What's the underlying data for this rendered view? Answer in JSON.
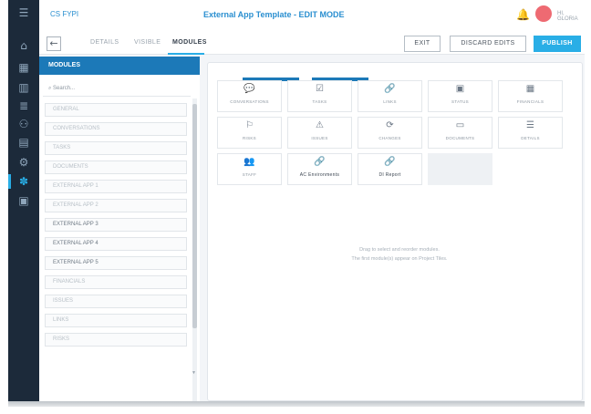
{
  "header": {
    "breadcrumb": "CS FYPI",
    "title": "External App Template - EDIT MODE",
    "user_label": "HI, GLORIA"
  },
  "rail": {
    "icons": [
      "menu-icon",
      "home-icon",
      "grid-icon",
      "chart-icon",
      "list-icon",
      "people-icon",
      "folder-icon",
      "settings-icon",
      "puzzle-icon",
      "calendar-icon"
    ],
    "active_index": 8
  },
  "tabs": [
    {
      "label": "DETAILS",
      "active": false
    },
    {
      "label": "VISIBLE",
      "active": false
    },
    {
      "label": "MODULES",
      "active": true
    }
  ],
  "buttons": {
    "exit": "EXIT",
    "discard": "DISCARD EDITS",
    "publish": "PUBLISH"
  },
  "modules_panel": {
    "title": "MODULES",
    "search_placeholder": "Search...",
    "items": [
      {
        "label": "GENERAL",
        "dark": false
      },
      {
        "label": "CONVERSATIONS",
        "dark": false
      },
      {
        "label": "TASKS",
        "dark": false
      },
      {
        "label": "DOCUMENTS",
        "dark": false
      },
      {
        "label": "EXTERNAL APP 1",
        "dark": false
      },
      {
        "label": "EXTERNAL APP 2",
        "dark": false
      },
      {
        "label": "EXTERNAL APP 3",
        "dark": true
      },
      {
        "label": "EXTERNAL APP 4",
        "dark": true
      },
      {
        "label": "EXTERNAL APP 5",
        "dark": true
      },
      {
        "label": "FINANCIALS",
        "dark": false
      },
      {
        "label": "ISSUES",
        "dark": false
      },
      {
        "label": "LINKS",
        "dark": false
      },
      {
        "label": "RISKS",
        "dark": false
      }
    ]
  },
  "board": {
    "tiles": [
      {
        "label": "CONVERSATIONS",
        "icon": "chat-icon",
        "glyph": "💬",
        "dark": false
      },
      {
        "label": "TASKS",
        "icon": "checklist-icon",
        "glyph": "☑",
        "dark": false
      },
      {
        "label": "LINKS",
        "icon": "link-icon",
        "glyph": "🔗",
        "dark": false
      },
      {
        "label": "STATUS",
        "icon": "status-icon",
        "glyph": "▣",
        "dark": false
      },
      {
        "label": "FINANCIALS",
        "icon": "financials-icon",
        "glyph": "▦",
        "dark": false
      },
      {
        "label": "RISKS",
        "icon": "flag-icon",
        "glyph": "⚐",
        "dark": false
      },
      {
        "label": "ISSUES",
        "icon": "warning-icon",
        "glyph": "⚠",
        "dark": false
      },
      {
        "label": "CHANGES",
        "icon": "changes-icon",
        "glyph": "⟳",
        "dark": false
      },
      {
        "label": "DOCUMENTS",
        "icon": "document-icon",
        "glyph": "▭",
        "dark": false
      },
      {
        "label": "DETAILS",
        "icon": "details-icon",
        "glyph": "☰",
        "dark": false
      },
      {
        "label": "STAFF",
        "icon": "staff-icon",
        "glyph": "👥",
        "dark": false
      },
      {
        "label": "AC Environments",
        "icon": "link-icon",
        "glyph": "🔗",
        "dark": true
      },
      {
        "label": "DI Report",
        "icon": "link-icon",
        "glyph": "🔗",
        "dark": true
      },
      {
        "label": "",
        "icon": "",
        "glyph": "",
        "dark": false,
        "empty": true
      }
    ],
    "hint_line1": "Drag to select and reorder modules.",
    "hint_line2": "The first module(s) appear on Project Tiles."
  }
}
